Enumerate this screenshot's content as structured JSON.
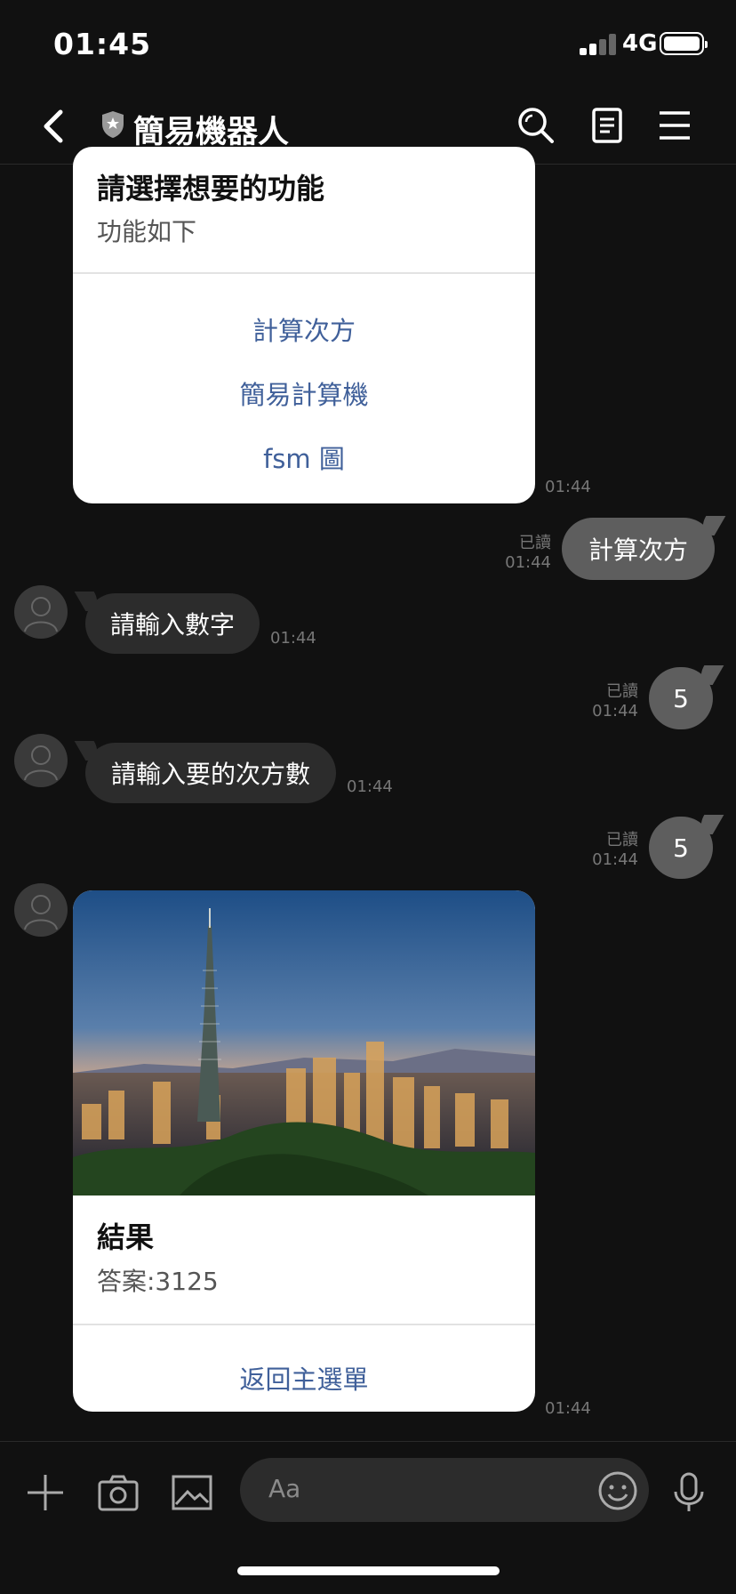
{
  "status": {
    "time": "01:45",
    "network": "4G"
  },
  "header": {
    "title": "簡易機器人"
  },
  "messages": {
    "menu_card": {
      "title": "請選擇想要的功能",
      "subtitle": "功能如下",
      "actions": [
        "計算次方",
        "簡易計算機",
        "fsm 圖"
      ],
      "time": "01:44"
    },
    "me1": {
      "text": "計算次方",
      "read": "已讀",
      "time": "01:44"
    },
    "bot1": {
      "text": "請輸入數字",
      "time": "01:44"
    },
    "me2": {
      "text": "5",
      "read": "已讀",
      "time": "01:44"
    },
    "bot2": {
      "text": "請輸入要的次方數",
      "time": "01:44"
    },
    "me3": {
      "text": "5",
      "read": "已讀",
      "time": "01:44"
    },
    "result_card": {
      "title": "結果",
      "subtitle": "答案:3125",
      "action": "返回主選單",
      "time": "01:44"
    }
  },
  "input": {
    "placeholder": "Aa"
  },
  "colors": {
    "background": "#111111",
    "my_bubble": "#5e5e5e",
    "bot_bubble": "#2c2c2c",
    "card_action": "#40609a"
  }
}
